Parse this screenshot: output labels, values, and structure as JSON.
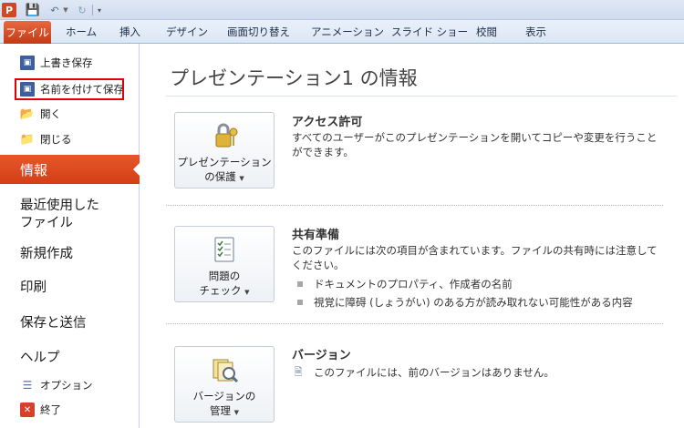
{
  "quick_access": {
    "app_icon": "P",
    "icons": [
      "powerpoint-app-icon",
      "save-icon",
      "undo-icon",
      "redo-icon",
      "customize-icon"
    ]
  },
  "ribbon": {
    "tabs": [
      {
        "label": "ファイル"
      },
      {
        "label": "ホーム"
      },
      {
        "label": "挿入"
      },
      {
        "label": "デザイン"
      },
      {
        "label": "画面切り替え"
      },
      {
        "label": "アニメーション"
      },
      {
        "label": "スライド ショー"
      },
      {
        "label": "校閲"
      },
      {
        "label": "表示"
      }
    ]
  },
  "leftnav": {
    "top_commands": [
      {
        "label": "上書き保存",
        "icon": "save-icon"
      },
      {
        "label": "名前を付けて保存",
        "icon": "save-as-icon"
      },
      {
        "label": "開く",
        "icon": "open-folder-icon"
      },
      {
        "label": "閉じる",
        "icon": "close-folder-icon"
      }
    ],
    "active": "情報",
    "sections": [
      {
        "label": "最近使用した"
      },
      {
        "label": "ファイル"
      },
      {
        "label": "新規作成"
      },
      {
        "label": "印刷"
      },
      {
        "label": "保存と送信"
      },
      {
        "label": "ヘルプ"
      }
    ],
    "bottom_commands": [
      {
        "label": "オプション",
        "icon": "options-icon"
      },
      {
        "label": "終了",
        "icon": "exit-icon"
      }
    ]
  },
  "main": {
    "title": "プレゼンテーション1 の情報",
    "protect": {
      "button_line1": "プレゼンテーション",
      "button_line2": "の保護",
      "heading": "アクセス許可",
      "text": "すべてのユーザーがこのプレゼンテーションを開いてコピーや変更を行うことができます。"
    },
    "prepare": {
      "button_line1": "問題の",
      "button_line2": "チェック",
      "heading": "共有準備",
      "text": "このファイルには次の項目が含まれています。ファイルの共有時には注意してください。",
      "bullets": [
        "ドキュメントのプロパティ、作成者の名前",
        "視覚に障碍 (しょうがい) のある方が読み取れない可能性がある内容"
      ]
    },
    "versions": {
      "button_line1": "バージョンの",
      "button_line2": "管理",
      "heading": "バージョン",
      "text": "このファイルには、前のバージョンはありません。"
    }
  },
  "colors": {
    "accent": "#d84a1f",
    "highlight_box": "#e30000"
  }
}
